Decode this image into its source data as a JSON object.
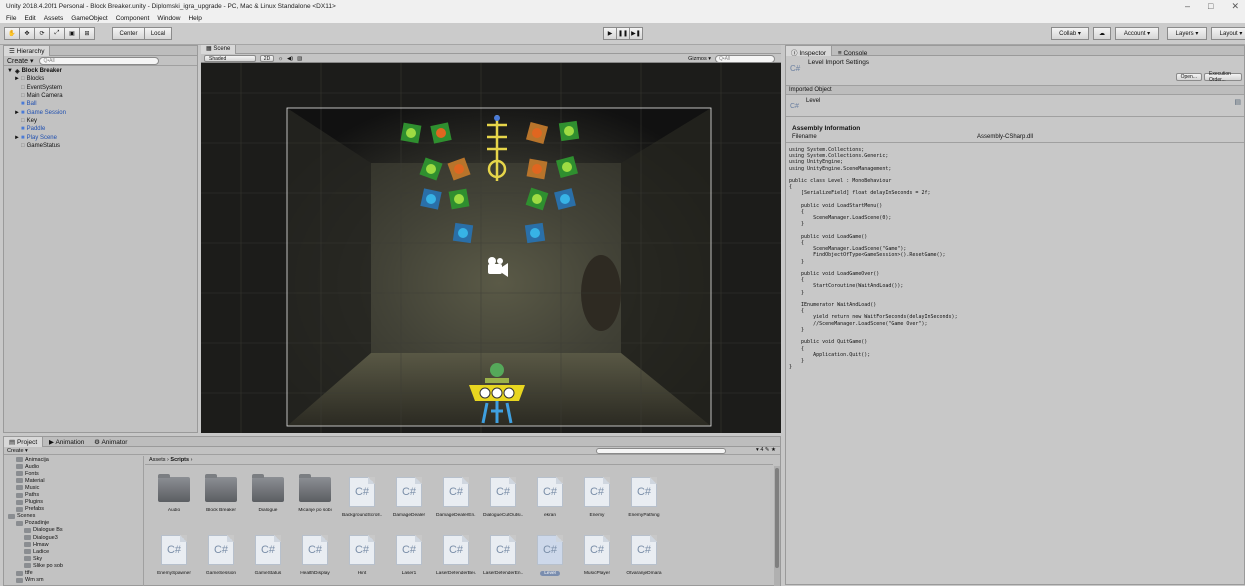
{
  "window": {
    "title": "Unity 2018.4.20f1 Personal - Block Breaker.unity - Diplomski_igra_upgrade - PC, Mac & Linux Standalone <DX11>",
    "minimize": "–",
    "maximize": "□",
    "close": "✕"
  },
  "menu": [
    "File",
    "Edit",
    "Assets",
    "GameObject",
    "Component",
    "Window",
    "Help"
  ],
  "toolbar": {
    "pivot_label": "Center",
    "space_label": "Local",
    "collab_label": "Collab ▾",
    "account_label": "Account ▾",
    "layers_label": "Layers ▾",
    "layout_label": "Layout ▾"
  },
  "hierarchy": {
    "tab": "Hierarchy",
    "create_label": "Create ▾",
    "search_placeholder": "Q•All",
    "scene_name": "Block Breaker",
    "items": [
      {
        "label": "Blocks",
        "indent": 1,
        "arrow": "►"
      },
      {
        "label": "EventSystem",
        "indent": 1,
        "arrow": ""
      },
      {
        "label": "Main Camera",
        "indent": 1,
        "arrow": ""
      },
      {
        "label": "Ball",
        "indent": 1,
        "arrow": "",
        "prefab": true
      },
      {
        "label": "Game Session",
        "indent": 1,
        "arrow": "►",
        "prefab": true
      },
      {
        "label": "Key",
        "indent": 1,
        "arrow": ""
      },
      {
        "label": "Paddle",
        "indent": 1,
        "arrow": "",
        "prefab": true
      },
      {
        "label": "Play Scene",
        "indent": 1,
        "arrow": "►",
        "prefab": true
      },
      {
        "label": "GameStatus",
        "indent": 1,
        "arrow": ""
      }
    ]
  },
  "scene": {
    "tab": "Scene",
    "shading": "Shaded",
    "mode_2d": "2D",
    "gizmos": "Gizmos ▾",
    "search_placeholder": "Q•All"
  },
  "inspector": {
    "tab_inspector": "Inspector",
    "tab_console": "Console",
    "header_title": "Level Import Settings",
    "open_btn": "Open...",
    "exec_btn": "Execution Order...",
    "imported_object_label": "Imported Object",
    "object_name": "Level",
    "assembly_heading": "Assembly Information",
    "filename_label": "Filename",
    "filename_value": "Assembly-CSharp.dll",
    "code": "using System.Collections;\nusing System.Collections.Generic;\nusing UnityEngine;\nusing UnityEngine.SceneManagement;\n\npublic class Level : MonoBehaviour\n{\n    [SerializeField] float delayInSeconds = 2f;\n\n    public void LoadStartMenu()\n    {\n        SceneManager.LoadScene(0);\n    }\n\n    public void LoadGame()\n    {\n        SceneManager.LoadScene(\"Game\");\n        FindObjectOfType<GameSession>().ResetGame();\n    }\n\n    public void LoadGameOver()\n    {\n        StartCoroutine(WaitAndLoad());\n    }\n\n    IEnumerator WaitAndLoad()\n    {\n        yield return new WaitForSeconds(delayInSeconds);\n        //SceneManager.LoadScene(\"Game Over\");\n    }\n\n    public void QuitGame()\n    {\n        Application.Quit();\n    }\n}"
  },
  "project": {
    "tab_project": "Project",
    "tab_animation": "Animation",
    "tab_animator": "Animator",
    "create_label": "Create ▾",
    "breadcrumb_root": "Assets",
    "breadcrumb_sep": "›",
    "breadcrumb_current": "Scripts",
    "tree": [
      {
        "label": "Animacija",
        "indent": 1
      },
      {
        "label": "Audio",
        "indent": 1
      },
      {
        "label": "Fonts",
        "indent": 1
      },
      {
        "label": "Material",
        "indent": 1
      },
      {
        "label": "Music",
        "indent": 1
      },
      {
        "label": "Paths",
        "indent": 1
      },
      {
        "label": "Plugins",
        "indent": 1
      },
      {
        "label": "Prefabs",
        "indent": 1
      },
      {
        "label": "Scenes",
        "indent": 0
      },
      {
        "label": "Pozadinje",
        "indent": 1
      },
      {
        "label": "Dialogue Bs",
        "indent": 2
      },
      {
        "label": "Dialogue3",
        "indent": 2
      },
      {
        "label": "Hmaw",
        "indent": 2
      },
      {
        "label": "Ladice",
        "indent": 2
      },
      {
        "label": "Sky",
        "indent": 2
      },
      {
        "label": "Slike po sob",
        "indent": 2
      },
      {
        "label": "ttfe",
        "indent": 1
      },
      {
        "label": "Wm sm",
        "indent": 1
      }
    ],
    "row1": [
      {
        "name": "Audio",
        "type": "folder"
      },
      {
        "name": "Block Breaker",
        "type": "folder"
      },
      {
        "name": "Dialogue",
        "type": "folder"
      },
      {
        "name": "Micanje po sobi",
        "type": "folder"
      },
      {
        "name": "BackgroundScroll...",
        "type": "cs"
      },
      {
        "name": "DamageDealer",
        "type": "cs"
      },
      {
        "name": "DamageDealerEn...",
        "type": "cs"
      },
      {
        "name": "DialogueCutOutsi...",
        "type": "cs"
      },
      {
        "name": "ekran",
        "type": "cs"
      },
      {
        "name": "Enemy",
        "type": "cs"
      },
      {
        "name": "EnemyPathing",
        "type": "cs"
      }
    ],
    "row2": [
      {
        "name": "EnemySpawner",
        "type": "cs"
      },
      {
        "name": "GameSession",
        "type": "cs"
      },
      {
        "name": "GameStatus",
        "type": "cs"
      },
      {
        "name": "HealthDisplay",
        "type": "cs"
      },
      {
        "name": "Hint",
        "type": "cs"
      },
      {
        "name": "Laser1",
        "type": "cs"
      },
      {
        "name": "LaserDefenderBei...",
        "type": "cs"
      },
      {
        "name": "LaserDefenderEn...",
        "type": "cs"
      },
      {
        "name": "Level",
        "type": "cs",
        "selected": true
      },
      {
        "name": "MusicPlayer",
        "type": "cs"
      },
      {
        "name": "OtvaranjeDmara",
        "type": "cs"
      }
    ],
    "cs_glyph": "C#",
    "counter": "4"
  }
}
